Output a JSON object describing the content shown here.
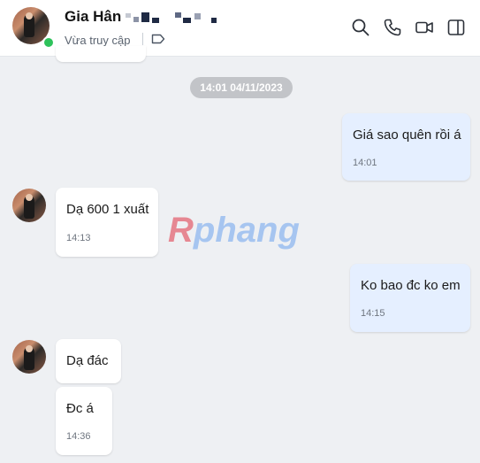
{
  "header": {
    "contact_name": "Gia Hân",
    "status": "Vừa truy cập",
    "icons": [
      "search-icon",
      "phone-icon",
      "video-call-icon",
      "sidebar-toggle-icon"
    ]
  },
  "timeline": {
    "date_label": "14:01 04/11/2023"
  },
  "messages": [
    {
      "direction": "out",
      "text": "Giá sao quên rồi á",
      "time": "14:01"
    },
    {
      "direction": "in",
      "text": "Dạ 600 1 xuất",
      "time": "14:13"
    },
    {
      "direction": "out",
      "text": "Ko bao đc ko em",
      "time": "14:15"
    },
    {
      "direction": "in",
      "text": "Dạ đác",
      "time": ""
    },
    {
      "direction": "in",
      "text": "Đc á",
      "time": "14:36"
    }
  ],
  "watermark": {
    "first": "R",
    "rest": "phang"
  },
  "colors": {
    "outgoing_bubble": "#e5efff",
    "incoming_bubble": "#ffffff",
    "online": "#2ec25b",
    "background": "#eef0f3"
  }
}
